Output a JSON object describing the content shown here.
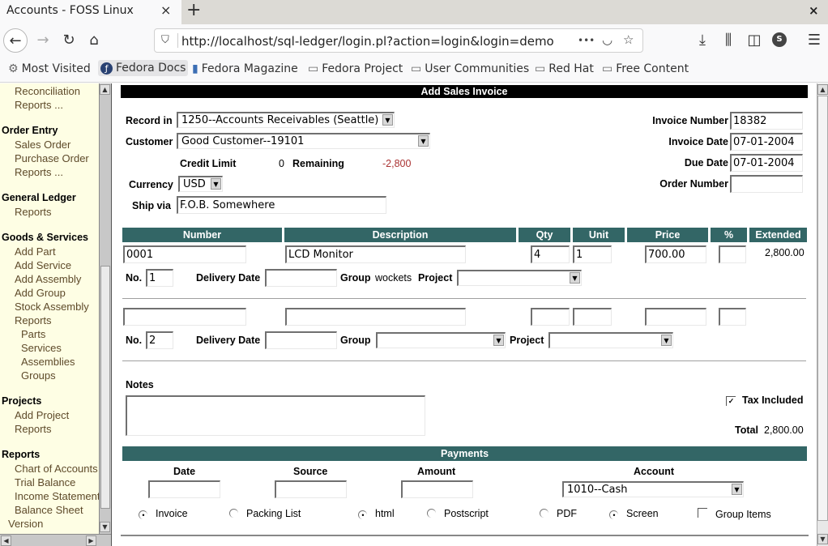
{
  "browser": {
    "tab_title": "Accounts - FOSS Linux",
    "tab_close": "×",
    "new_tab": "+",
    "window_close": "×",
    "url": "http://localhost/sql-ledger/login.pl?action=login&login=demo",
    "icons": {
      "back": "←",
      "forward": "→",
      "reload": "↻",
      "home": "⌂",
      "shield": "⛉",
      "more": "•••",
      "pocket": "◡",
      "star": "☆",
      "download": "⤓",
      "library": "⫼",
      "sidebar": "◫",
      "account": "S",
      "menu": "☰"
    },
    "bookmarks": [
      {
        "label": "Most Visited",
        "icon": "⚙"
      },
      {
        "label": "Fedora Docs",
        "icon": "ƒ"
      },
      {
        "label": "Fedora Magazine",
        "icon": "▮"
      },
      {
        "label": "Fedora Project",
        "icon": "▭"
      },
      {
        "label": "User Communities",
        "icon": "▭"
      },
      {
        "label": "Red Hat",
        "icon": "▭"
      },
      {
        "label": "Free Content",
        "icon": "▭"
      }
    ]
  },
  "menu": {
    "sections": [
      {
        "items": [
          "Reconciliation",
          "Reports ..."
        ]
      },
      {
        "head": "Order Entry",
        "items": [
          "Sales Order",
          "Purchase Order",
          "Reports ..."
        ]
      },
      {
        "head": "General Ledger",
        "items": [
          "Reports"
        ]
      },
      {
        "head": "Goods & Services",
        "items": [
          "Add Part",
          "Add Service",
          "Add Assembly",
          "Add Group",
          "Stock Assembly",
          "Reports"
        ],
        "subitems": [
          "Parts",
          "Services",
          "Assemblies",
          "Groups"
        ]
      },
      {
        "head": "Projects",
        "items": [
          "Add Project",
          "Reports"
        ]
      },
      {
        "head": "Reports",
        "items": [
          "Chart of Accounts",
          "Trial Balance",
          "Income Statement",
          "Balance Sheet"
        ]
      }
    ],
    "version": "Version"
  },
  "form": {
    "title": "Add Sales Invoice",
    "record_in_label": "Record in",
    "record_in_value": "1250--Accounts Receivables (Seattle)",
    "customer_label": "Customer",
    "customer_value": "Good Customer--19101",
    "credit_limit_label": "Credit Limit",
    "credit_limit_value": "0",
    "remaining_label": "Remaining",
    "remaining_value": "-2,800",
    "currency_label": "Currency",
    "currency_value": "USD",
    "ship_via_label": "Ship via",
    "ship_via_value": "F.O.B. Somewhere",
    "invoice_number_label": "Invoice Number",
    "invoice_number_value": "18382",
    "invoice_date_label": "Invoice Date",
    "invoice_date_value": "07-01-2004",
    "due_date_label": "Due Date",
    "due_date_value": "07-01-2004",
    "order_number_label": "Order Number",
    "order_number_value": "",
    "colors": {
      "header": "#336666",
      "remaining": "#aa3333"
    }
  },
  "lines": {
    "columns": [
      "Number",
      "Description",
      "Qty",
      "Unit",
      "Price",
      "%",
      "Extended"
    ],
    "rows": [
      {
        "number": "0001",
        "description": "LCD Monitor",
        "qty": "4",
        "unit": "1",
        "price": "700.00",
        "discount": "",
        "extended": "2,800.00",
        "no": "1",
        "group": "wockets"
      },
      {
        "number": "",
        "description": "",
        "qty": "",
        "unit": "",
        "price": "",
        "discount": "",
        "extended": "",
        "no": "2",
        "group": ""
      }
    ],
    "no_label": "No.",
    "delivery_date_label": "Delivery Date",
    "group_label": "Group",
    "project_label": "Project"
  },
  "notes_label": "Notes",
  "tax_included_label": "Tax Included",
  "tax_included_checked": true,
  "total_label": "Total",
  "total_value": "2,800.00",
  "payments": {
    "title": "Payments",
    "columns": [
      "Date",
      "Source",
      "Amount",
      "Account"
    ],
    "account_value": "1010--Cash"
  },
  "print_options": [
    {
      "label": "Invoice",
      "checked": true
    },
    {
      "label": "Packing List",
      "checked": false
    },
    {
      "label": "html",
      "checked": true
    },
    {
      "label": "Postscript",
      "checked": false
    },
    {
      "label": "PDF",
      "checked": false
    },
    {
      "label": "Screen",
      "checked": true
    }
  ],
  "group_items_label": "Group Items"
}
